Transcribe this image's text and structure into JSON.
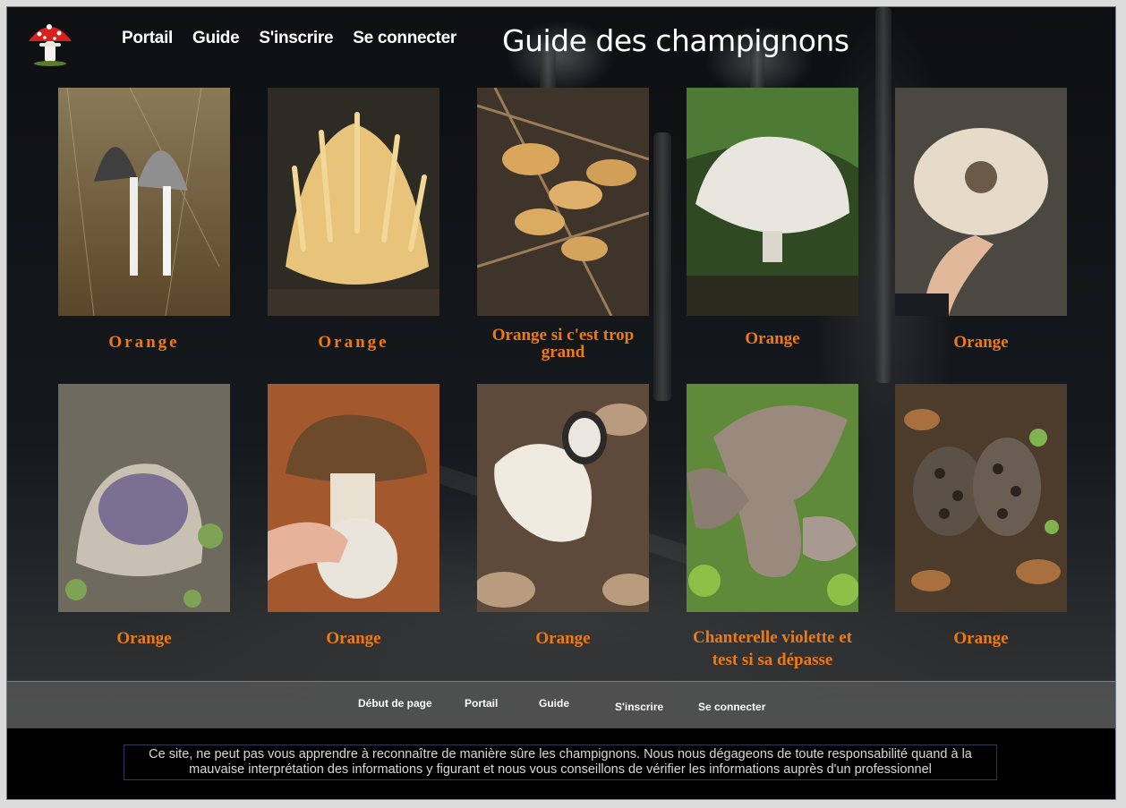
{
  "header": {
    "nav": [
      "Portail",
      "Guide",
      "S'inscrire",
      "Se connecter"
    ],
    "title": "Guide des champignons"
  },
  "cards": [
    {
      "caption": "Orange",
      "photo_icon": "inky-cap-mushroom"
    },
    {
      "caption": "Orange",
      "photo_icon": "coral-fungus"
    },
    {
      "caption": "Orange si c'est trop grand",
      "photo_icon": "chanterelle-cluster"
    },
    {
      "caption": "Orange",
      "photo_icon": "white-russula"
    },
    {
      "caption": "Orange",
      "photo_icon": "parasol-cap-in-hand"
    },
    {
      "caption": "Orange",
      "photo_icon": "violet-cup-fungus"
    },
    {
      "caption": "Orange",
      "photo_icon": "bolete-in-hand"
    },
    {
      "caption": "Orange",
      "photo_icon": "hedgehog-mushroom"
    },
    {
      "caption": "Chanterelle violette et test si sa dépasse",
      "photo_icon": "violet-chanterelle"
    },
    {
      "caption": "Orange",
      "photo_icon": "morel"
    }
  ],
  "footer_nav": [
    "Début de page",
    "Portail",
    "Guide",
    "S'inscrire",
    "Se connecter"
  ],
  "footer": {
    "disclaimer": "Ce site, ne peut pas vous apprendre à reconnaître de manière sûre les champignons. Nous nous dégageons de toute responsabilité quand à la mauvaise interprétation des informations y figurant et nous vous conseillons de vérifier les informations auprès d'un professionnel"
  },
  "colors": {
    "caption": "#f07a10",
    "footer_bg": "#000000",
    "footer_nav_border": "#4a8ac4"
  }
}
